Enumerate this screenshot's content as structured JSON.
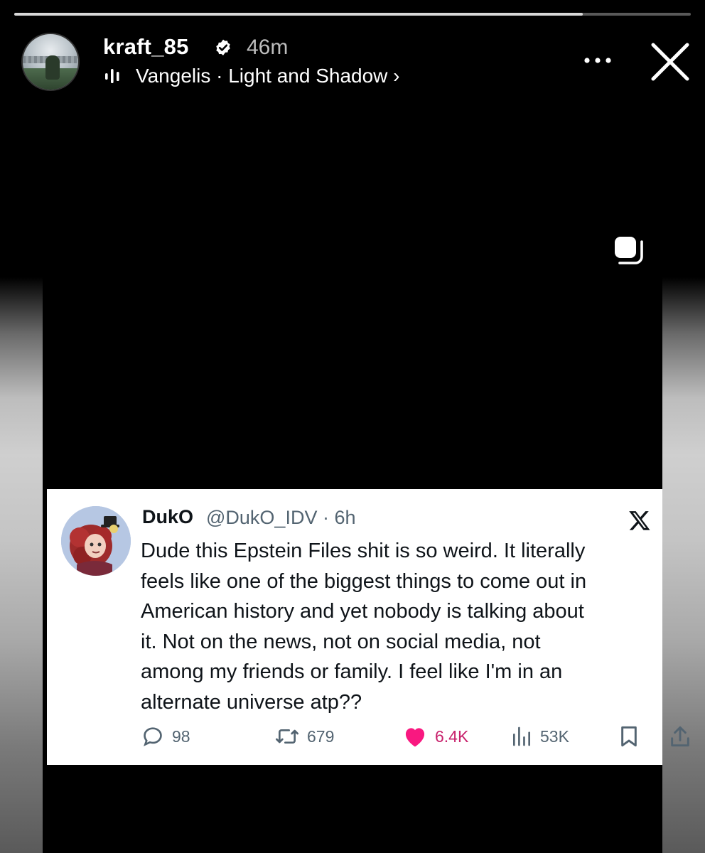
{
  "story": {
    "progress": 0.84,
    "username": "kraft_85",
    "time_ago": "46m",
    "music": {
      "artist": "Vangelis",
      "separator": " · ",
      "title": "Light and Shadow",
      "chevron": " ›"
    },
    "icons": {
      "verified": "verified-badge-icon",
      "more": "more-dots-icon",
      "close": "close-icon",
      "layers": "stacked-squares-icon",
      "music": "audio-bars-icon"
    }
  },
  "tweet": {
    "display_name": "DukO",
    "handle_time": "@DukO_IDV · 6h",
    "lines": [
      "Dude this Epstein Files shit is so weird. It literally",
      "feels like one of the biggest things to come out in",
      "American history and yet nobody is talking about",
      "it. Not on the news, not on social media, not",
      "among my friends or family. I feel like I'm in an",
      "alternate universe atp??"
    ],
    "stats": {
      "replies": "98",
      "reposts": "679",
      "likes": "6.4K",
      "views": "53K"
    },
    "colors": {
      "like": "#f91880",
      "muted": "#536471",
      "text": "#0f1419"
    }
  }
}
